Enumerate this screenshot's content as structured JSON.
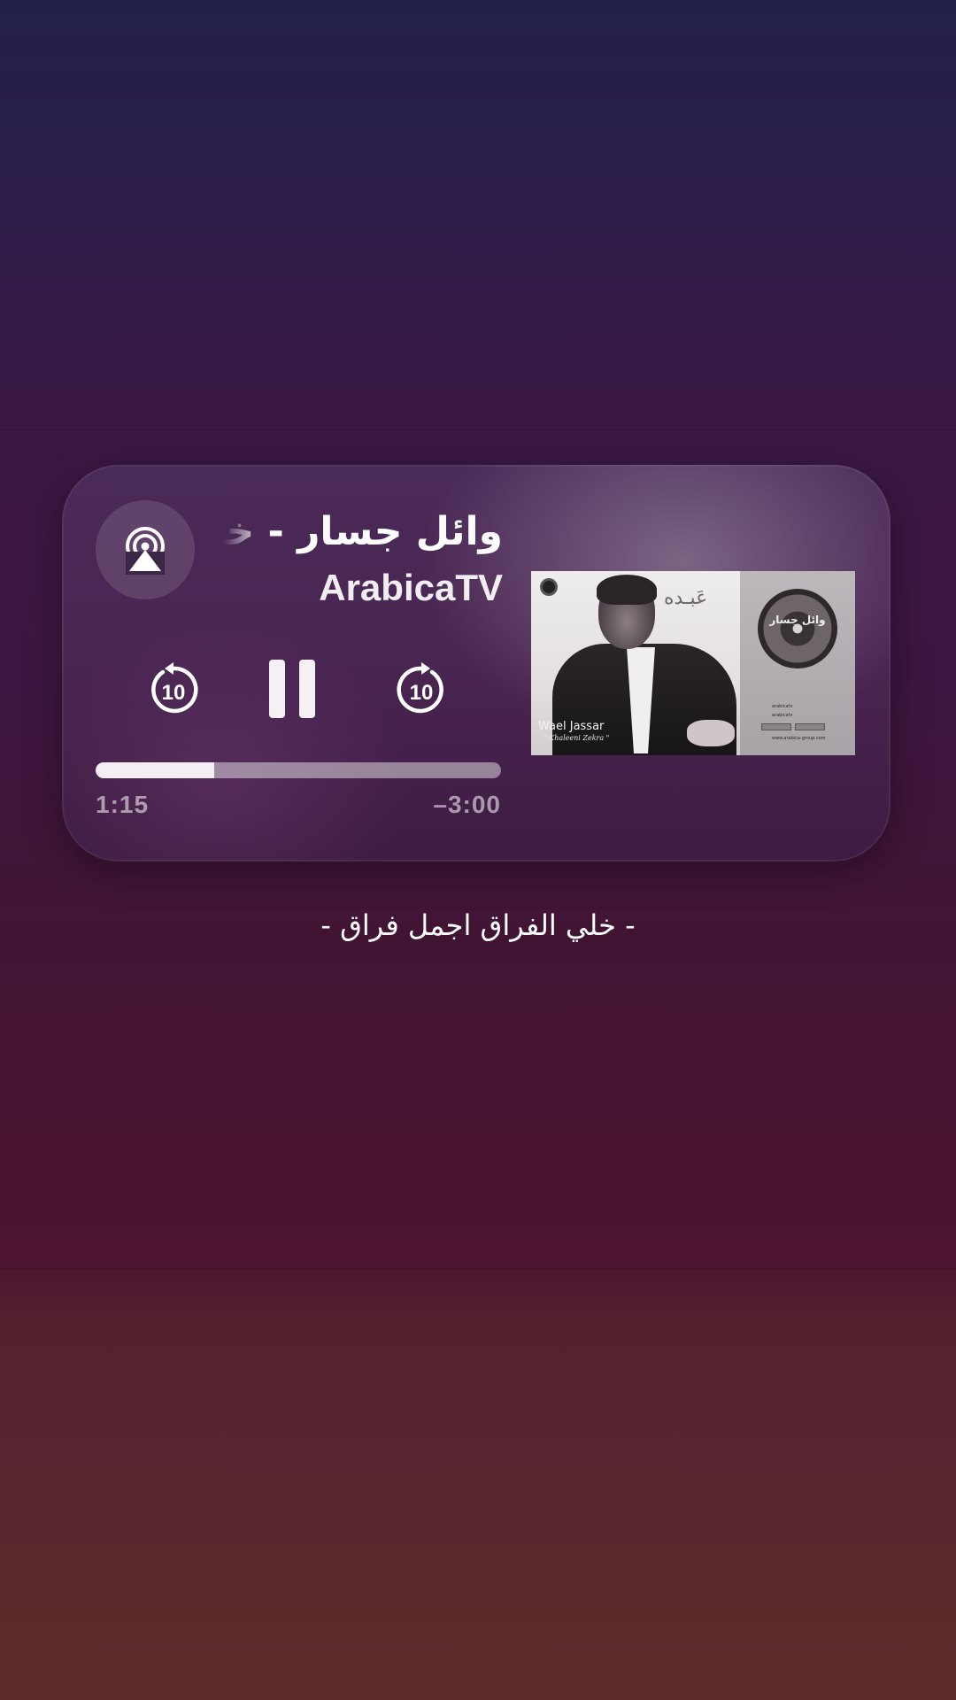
{
  "now_playing": {
    "title": "وائل جسار - خليه",
    "artist": "ArabicaTV",
    "elapsed": "1:15",
    "remaining": "–3:00",
    "progress": 0.293,
    "skip_back_seconds": "10",
    "skip_forward_seconds": "10"
  },
  "album_art": {
    "artist_name": "Wael Jassar",
    "album_name": "\" Khaleeni Zekra \"",
    "calligraphy": "عَبـده",
    "disc_text": "وائل جسار",
    "social_1": "arabicatv",
    "social_2": "arabicatv",
    "url": "www.arabica-group.com"
  },
  "caption": "- خلي الفراق اجمل فراق -",
  "icons": {
    "airplay": "airplay-audio-icon",
    "skip_back": "gobackward-10-icon",
    "pause": "pause-icon",
    "skip_forward": "goforward-10-icon"
  },
  "colors": {
    "text_primary": "#ffffff",
    "progress_fill": "#f2eef2",
    "progress_track": "rgba(255,255,255,0.45)"
  }
}
